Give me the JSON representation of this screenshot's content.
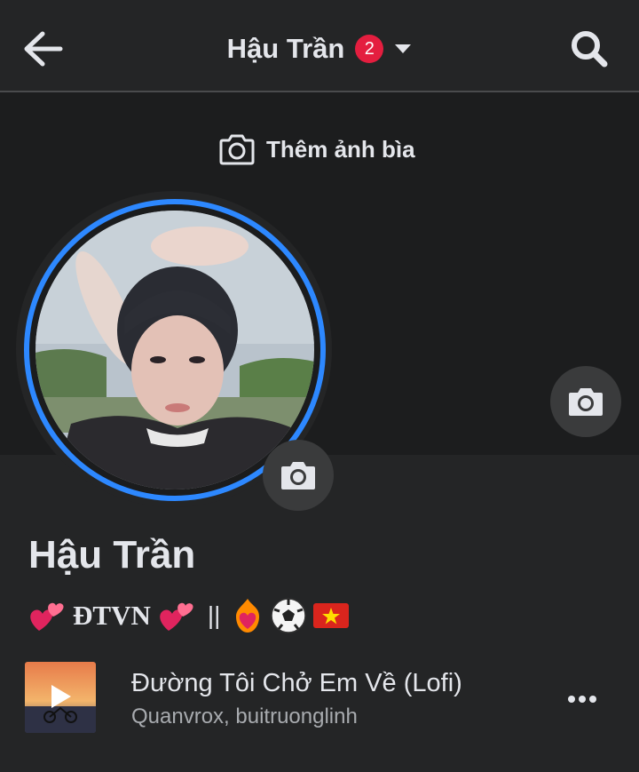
{
  "header": {
    "title": "Hậu Trần",
    "notification_count": "2",
    "back_icon": "arrow-left-icon",
    "dropdown_icon": "caret-down-icon",
    "search_icon": "search-icon"
  },
  "cover": {
    "add_cover_label": "Thêm ảnh bìa",
    "camera_icon": "camera-icon"
  },
  "profile": {
    "name": "Hậu Trần",
    "bio": {
      "text": "ĐTVN",
      "separator": "||",
      "emojis": [
        "two-hearts-icon",
        "two-hearts-icon",
        "heart-on-fire-icon",
        "soccer-ball-icon",
        "vietnam-flag-icon"
      ]
    }
  },
  "music": {
    "song_title": "Đường Tôi Chở Em Về (Lofi)",
    "artists": "Quanvrox, buitruonglinh",
    "play_icon": "play-icon",
    "more_icon": "more-horizontal-icon"
  },
  "colors": {
    "background": "#242526",
    "cover": "#1c1d1e",
    "accent": "#2d88ff",
    "badge": "#e41e3f",
    "text_primary": "#e4e6eb",
    "text_secondary": "#a8abaf"
  }
}
